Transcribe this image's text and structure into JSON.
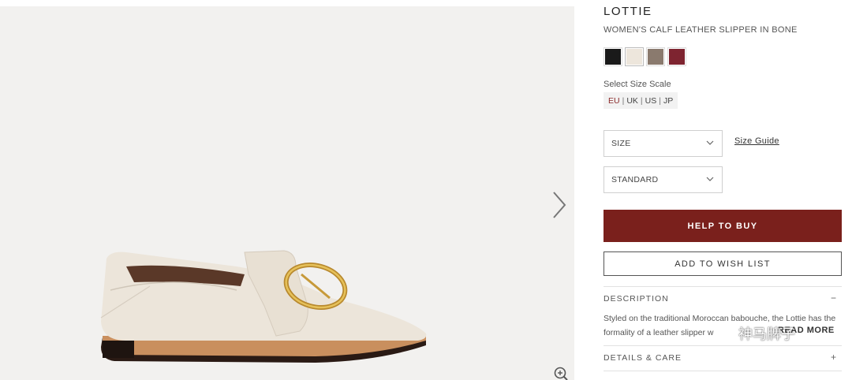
{
  "product": {
    "title": "LOTTIE",
    "subtitle": "WOMEN'S CALF LEATHER SLIPPER IN BONE"
  },
  "colors": {
    "swatches": [
      {
        "name": "black",
        "hex": "#1a1a1a"
      },
      {
        "name": "bone",
        "hex": "#ede6dc",
        "selected": true
      },
      {
        "name": "taupe",
        "hex": "#8a7a6e"
      },
      {
        "name": "burgundy",
        "hex": "#7e2430"
      }
    ],
    "accent": "#7a201c"
  },
  "size_scale": {
    "label": "Select Size Scale",
    "options": [
      "EU",
      "UK",
      "US",
      "JP"
    ],
    "active": "EU",
    "separator": "|"
  },
  "size_select": {
    "value": "SIZE"
  },
  "size_guide_label": "Size Guide",
  "fit_select": {
    "value": "STANDARD"
  },
  "buttons": {
    "help_to_buy": "HELP TO BUY",
    "add_to_wishlist": "ADD TO WISH LIST"
  },
  "description": {
    "heading": "DESCRIPTION",
    "toggle": "−",
    "text": "Styled on the traditional Moroccan babouche, the Lottie has the formality of a leather slipper w",
    "read_more": "READ MORE"
  },
  "details": {
    "heading": "DETAILS & CARE",
    "toggle": "+"
  },
  "watermark": {
    "text": "神马牌子"
  },
  "icons": {
    "next": "chevron-right-icon",
    "zoom": "zoom-in-icon",
    "dropdown": "chevron-down-icon"
  }
}
